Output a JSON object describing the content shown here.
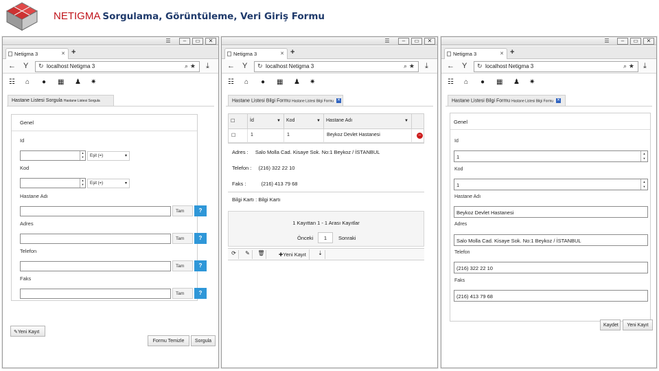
{
  "header": {
    "brand": "NETIGMA",
    "subtitle": "Sorgulama, Görüntüleme, Veri Giriş Formu"
  },
  "browser": {
    "tab_title": "Netigma 3",
    "url": "localhost Netigma 3"
  },
  "window1": {
    "form_tab": "Hastane Listesi Sorgula",
    "form_tab_small": "Hastane Listesi Sorgula",
    "legend": "Genel",
    "fields": [
      {
        "label": "Id",
        "operator": "Eşit (=)"
      },
      {
        "label": "Kod",
        "operator": "Eşit (=)"
      },
      {
        "label": "Hastane Adı",
        "button": "Tam"
      },
      {
        "label": "Adres",
        "button": "Tam"
      },
      {
        "label": "Telefon",
        "button": "Tam"
      },
      {
        "label": "Faks",
        "button": "Tam"
      }
    ],
    "help": "?",
    "new_record": "Yeni Kayıt",
    "clear_form": "Formu Temizle",
    "query": "Sorgula"
  },
  "window2": {
    "form_tab": "Hastane Listesi Bilgi Formu",
    "form_tab_small": "Hastane Listesi Bilgi Formu",
    "columns": [
      "İd",
      "Kod",
      "Hastane Adı"
    ],
    "row": {
      "id": "1",
      "kod": "1",
      "hastane_adi": "Beykoz Devlet Hastanesi"
    },
    "details": [
      {
        "label": "Adres :",
        "value": "Salo Molla Cad. Kisaye Sok. No:1 Beykoz / İSTANBUL"
      },
      {
        "label": "Telefon :",
        "value": "(216) 322 22 10"
      },
      {
        "label": "Faks :",
        "value": "(216) 413 79 68"
      }
    ],
    "bilgi_karti": "Bilgi Kartı : Bilgi Kartı",
    "pager_info": "1 Kayıttan 1 - 1 Arası Kayıtlar",
    "prev": "Önceki",
    "page": "1",
    "next": "Sonraki",
    "new_record": "Yeni Kayıt"
  },
  "window3": {
    "form_tab": "Hastane Listesi Bilgi Formu",
    "form_tab_small": "Hastane Listesi Bilgi Formu",
    "legend": "Genel",
    "fields": [
      {
        "label": "Id",
        "value": "1"
      },
      {
        "label": "Kod",
        "value": "1"
      },
      {
        "label": "Hastane Adı",
        "value": "Beykoz Devlet Hastanesi"
      },
      {
        "label": "Adres",
        "value": "Salo Molla Cad. Kisaye Sok. No:1 Beykoz / İSTANBUL"
      },
      {
        "label": "Telefon",
        "value": "(216) 322 22 10"
      },
      {
        "label": "Faks",
        "value": "(216) 413 79 68"
      }
    ],
    "save": "Kaydet",
    "new_record": "Yeni Kayıt"
  },
  "icons": {
    "window_controls": [
      "minimize-icon",
      "maximize-icon",
      "close-icon"
    ],
    "toolbar": [
      "menu-icon",
      "home-icon",
      "location-pin-icon",
      "calendar-icon",
      "user-icon",
      "gear-icon"
    ]
  },
  "colors": {
    "brand": "#c0141b",
    "subtitle": "#1f3a6b",
    "help_button": "#2f97d8",
    "tab_close": "#2f63c0",
    "delete": "#cc1d1d"
  }
}
